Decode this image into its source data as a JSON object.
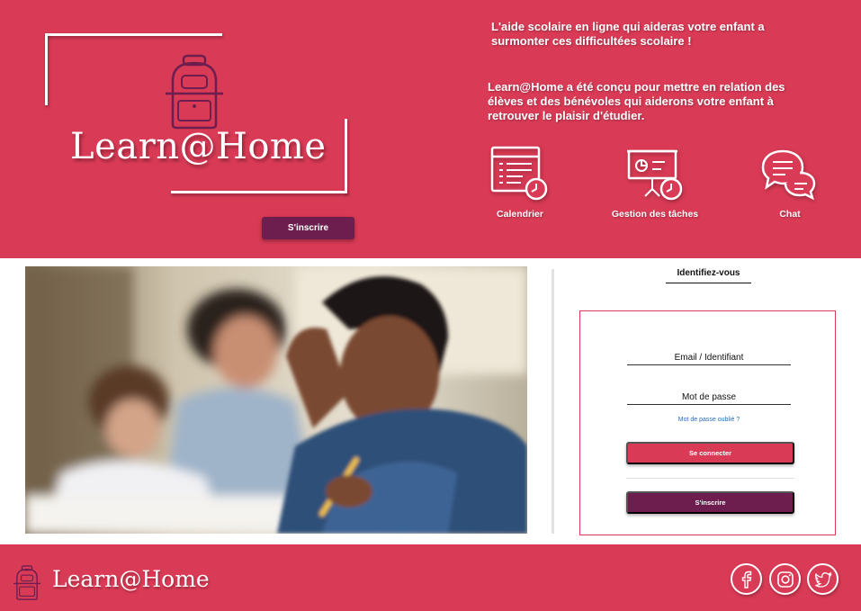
{
  "brand": {
    "name": "Learn@Home",
    "logo_icon": "backpack-icon"
  },
  "header": {
    "tagline": "L'aide scolaire en ligne qui aideras votre enfant a surmonter ces difficultées scolaire !",
    "description": "Learn@Home a été conçu pour mettre en relation des élèves et des bénévoles qui aiderons votre enfant à retrouver le plaisir d'étudier.",
    "register_label": "S'inscrire",
    "features": [
      {
        "label": "Calendrier",
        "icon": "calendar-clock-icon"
      },
      {
        "label": "Gestion des tâches",
        "icon": "task-board-clock-icon"
      },
      {
        "label": "Chat",
        "icon": "chat-bubbles-icon"
      }
    ]
  },
  "main": {
    "photo_icon": "student-studying-photo",
    "login": {
      "heading": "Identifiez-vous",
      "email_placeholder": "Email / Identifiant",
      "password_placeholder": "Mot de passe",
      "forgot_label": "Mot de passe oublié ?",
      "login_label": "Se connecter",
      "signup_label": "S'inscrire"
    }
  },
  "footer": {
    "social": [
      {
        "name": "facebook-icon"
      },
      {
        "name": "instagram-icon"
      },
      {
        "name": "twitter-icon"
      }
    ]
  },
  "colors": {
    "primary": "#d93a55",
    "secondary": "#6e1d4f",
    "link": "#2a6db5"
  }
}
